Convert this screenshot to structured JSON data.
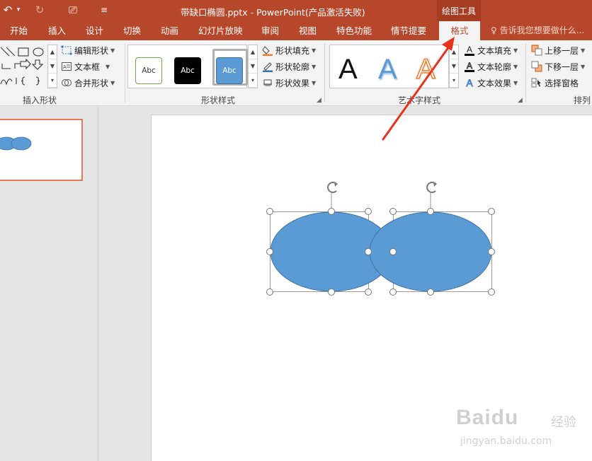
{
  "titlebar": {
    "title": "带缺口椭圆.pptx - PowerPoint(产品激活失败)",
    "contextual_group": "绘图工具",
    "qa_undo": "↶",
    "qa_undo_dd": "▾",
    "qa_redo": "↻",
    "qa_present": "⎚",
    "qa_customize": "≡"
  },
  "tabs": [
    {
      "label": "开始"
    },
    {
      "label": "插入"
    },
    {
      "label": "设计"
    },
    {
      "label": "切换"
    },
    {
      "label": "动画"
    },
    {
      "label": "幻灯片放映"
    },
    {
      "label": "审阅"
    },
    {
      "label": "视图"
    },
    {
      "label": "特色功能"
    },
    {
      "label": "情节提要"
    },
    {
      "label": "格式",
      "active": true
    }
  ],
  "tell_me": "告诉我您想要做什么...",
  "ribbon": {
    "insert_shapes": {
      "label": "插入形状",
      "edit_shape": "编辑形状",
      "text_box": "文本框",
      "merge_shapes": "合并形状"
    },
    "shape_styles": {
      "label": "形状样式",
      "swatches": [
        "Abc",
        "Abc",
        "Abc"
      ],
      "fill": "形状填充",
      "outline": "形状轮廓",
      "effects": "形状效果"
    },
    "wordart_styles": {
      "label": "艺术字样式",
      "letters": [
        "A",
        "A",
        "A"
      ],
      "text_fill": "文本填充",
      "text_outline": "文本轮廓",
      "text_effects": "文本效果"
    },
    "arrange": {
      "label": "排列",
      "bring_forward": "上移一层",
      "send_backward": "下移一层",
      "selection_pane": "选择窗格"
    }
  },
  "slide": {
    "shape_fill": "#5b9bd5",
    "shape_outline": "#41719c"
  },
  "colors": {
    "accent": "#b7472a",
    "annotation_arrow": "#e8321e",
    "thumb_border": "#e8765a"
  },
  "watermark": {
    "logo": "Baidu",
    "sub": "经验",
    "url": "jingyan.baidu.com"
  }
}
